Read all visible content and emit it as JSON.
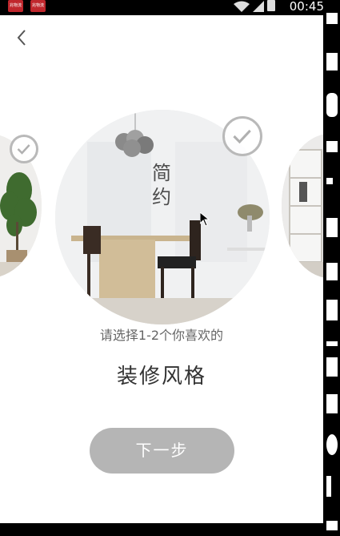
{
  "status_bar": {
    "time": "00:45",
    "app_icons": [
      {
        "label": "兆物流"
      },
      {
        "label": "兆物流"
      }
    ]
  },
  "styles": [
    {
      "name": "",
      "checked": true
    },
    {
      "name": "简约",
      "checked": true
    },
    {
      "name": "",
      "checked": false
    }
  ],
  "prompt": "请选择1-2个你喜欢的",
  "title": "装修风格",
  "next_button": "下一步",
  "colors": {
    "screen_bg": "#ffffff",
    "button_bg": "#b5b5b5",
    "button_text": "#ffffff",
    "check_border": "#b9b9b9",
    "title_text": "#333333",
    "prompt_text": "#666666"
  },
  "icons": {
    "back": "chevron-left-icon",
    "check": "check-circle-icon"
  }
}
